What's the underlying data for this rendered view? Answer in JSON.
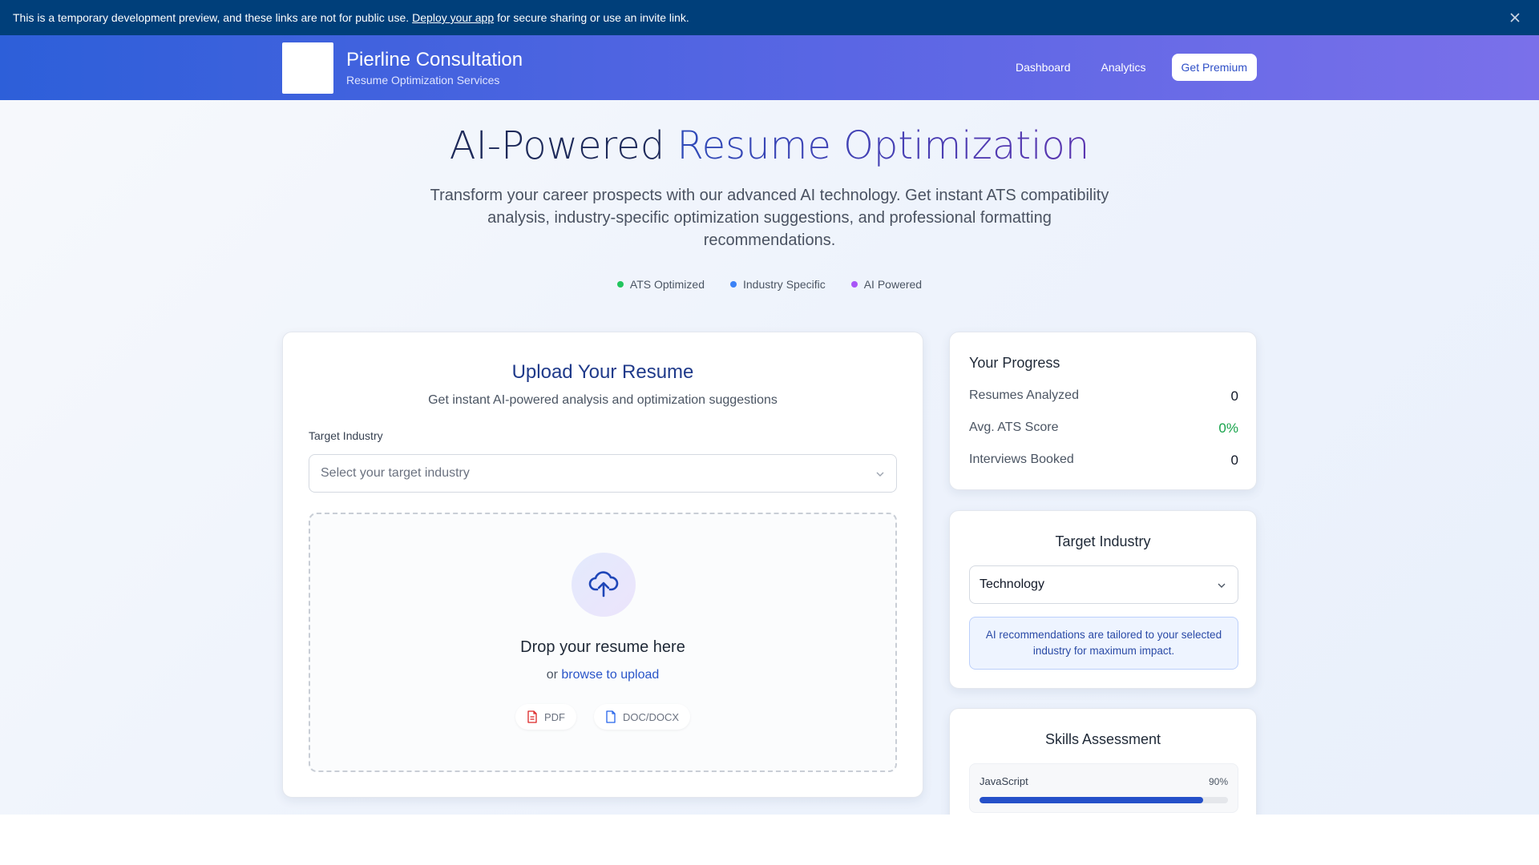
{
  "banner": {
    "text_before": "This is a temporary development preview, and these links are not for public use.",
    "link": "Deploy your app",
    "text_after": "for secure sharing or use an invite link."
  },
  "header": {
    "brand_title": "Pierline Consultation",
    "brand_subtitle": "Resume Optimization Services",
    "nav": {
      "dashboard": "Dashboard",
      "analytics": "Analytics",
      "premium": "Get Premium"
    }
  },
  "hero": {
    "title_plain": "AI-Powered ",
    "title_gradient": "Resume Optimization",
    "description": "Transform your career prospects with our advanced AI technology. Get instant ATS compatibility analysis, industry-specific optimization suggestions, and professional formatting recommendations.",
    "features": [
      {
        "label": "ATS Optimized",
        "color": "#22c55e"
      },
      {
        "label": "Industry Specific",
        "color": "#3b82f6"
      },
      {
        "label": "AI Powered",
        "color": "#a855f7"
      }
    ]
  },
  "upload": {
    "title": "Upload Your Resume",
    "subtitle": "Get instant AI-powered analysis and optimization suggestions",
    "industry_label": "Target Industry",
    "industry_placeholder": "Select your target industry",
    "drop_title": "Drop your resume here",
    "drop_or": "or",
    "browse_link": "browse to upload",
    "formats": [
      {
        "label": "PDF",
        "icon": "pdf-file-icon"
      },
      {
        "label": "DOC/DOCX",
        "icon": "doc-file-icon"
      }
    ]
  },
  "progress": {
    "title": "Your Progress",
    "stats": [
      {
        "label": "Resumes Analyzed",
        "value": "0"
      },
      {
        "label": "Avg. ATS Score",
        "value": "0%"
      },
      {
        "label": "Interviews Booked",
        "value": "0"
      }
    ]
  },
  "target_industry": {
    "title": "Target Industry",
    "selected": "Technology",
    "info": "AI recommendations are tailored to your selected industry for maximum impact."
  },
  "skills": {
    "title": "Skills Assessment",
    "items": [
      {
        "name": "JavaScript",
        "percent_label": "90%",
        "percent": 90
      }
    ]
  },
  "colors": {
    "banner_bg": "#003f7a",
    "header_gradient_start": "#2d5fd9",
    "header_gradient_end": "#7a70ea",
    "accent": "#2a55c9",
    "success": "#16a34a"
  }
}
